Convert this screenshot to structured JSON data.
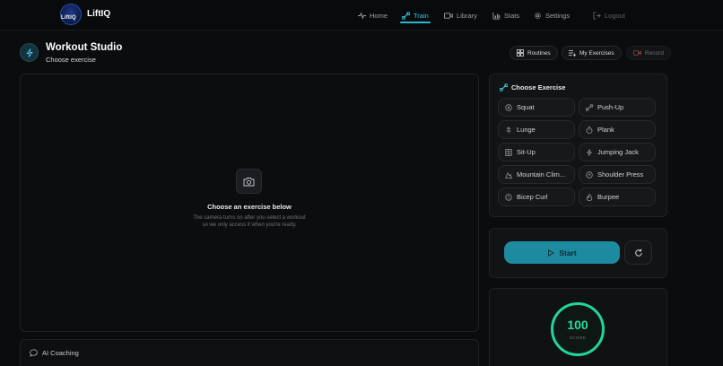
{
  "app": {
    "brand": "LiftIQ",
    "logo_text": "LiftIQ"
  },
  "nav": {
    "home": "Home",
    "train": "Train",
    "library": "Library",
    "stats": "Stats",
    "settings": "Settings",
    "logout": "Logout",
    "active": "Train",
    "accent_color": "#3fc6df"
  },
  "header": {
    "title": "Workout Studio",
    "subtitle": "Choose exercise",
    "routines": "Routines",
    "my_exercises": "My Exercises",
    "record": "Record"
  },
  "camera": {
    "title": "Choose an exercise below",
    "text": "The camera turns on after you select a workout so we only access it when you're ready."
  },
  "coaching": {
    "label": "AI Coaching"
  },
  "exercises": {
    "heading": "Choose Exercise",
    "items": [
      {
        "label": "Squat",
        "icon": "target-icon"
      },
      {
        "label": "Push-Up",
        "icon": "dumbbell-icon"
      },
      {
        "label": "Lunge",
        "icon": "arrow-up-icon"
      },
      {
        "label": "Plank",
        "icon": "timer-icon"
      },
      {
        "label": "Sit-Up",
        "icon": "grid-icon"
      },
      {
        "label": "Jumping Jack",
        "icon": "bolt-icon"
      },
      {
        "label": "Mountain Clim...",
        "icon": "mountain-icon"
      },
      {
        "label": "Shoulder Press",
        "icon": "circle-arrow-icon"
      },
      {
        "label": "Bicep Curl",
        "icon": "curl-icon"
      },
      {
        "label": "Burpee",
        "icon": "flame-icon"
      }
    ]
  },
  "controls": {
    "start": "Start"
  },
  "score": {
    "value": "100",
    "label": "SCORE",
    "color": "#22d59a"
  }
}
